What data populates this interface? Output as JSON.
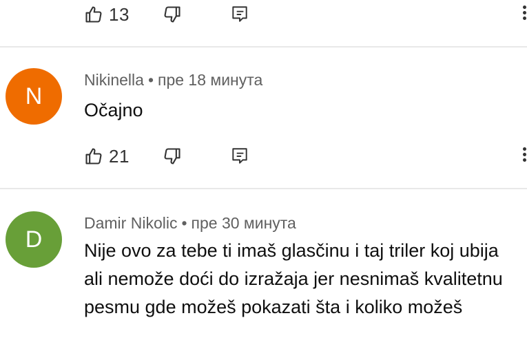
{
  "icons": {
    "like": "thumbs-up-icon",
    "dislike": "thumbs-down-icon",
    "reply": "reply-icon",
    "more": "more-vert-icon"
  },
  "avatar_colors": {
    "N": "#ef6c00",
    "D": "#689f38"
  },
  "previous_comment": {
    "likes": "13"
  },
  "comments": [
    {
      "avatar_letter": "N",
      "author": "Nikinella",
      "separator": "•",
      "time": "пре 18 минута",
      "text": "Očajno",
      "likes": "21"
    },
    {
      "avatar_letter": "D",
      "author": "Damir Nikolic",
      "separator": "•",
      "time": "пре 30 минута",
      "text": "Nije ovo za tebe ti imaš glasčinu i taj triler koj ubija ali nemože doći do izražaja jer nesnimaš kvalitetnu pesmu gde možeš pokazati šta i koliko  možeš"
    }
  ]
}
